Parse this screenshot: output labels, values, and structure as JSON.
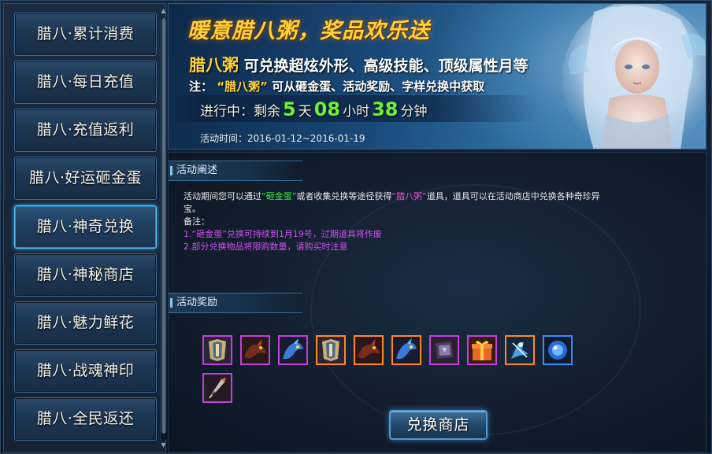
{
  "sidebar": {
    "items": [
      {
        "label": "腊八·累计消费"
      },
      {
        "label": "腊八·每日充值"
      },
      {
        "label": "腊八·充值返利"
      },
      {
        "label": "腊八·好运砸金蛋"
      },
      {
        "label": "腊八·神奇兑换"
      },
      {
        "label": "腊八·神秘商店"
      },
      {
        "label": "腊八·魅力鲜花"
      },
      {
        "label": "腊八·战魂神印"
      },
      {
        "label": "腊八·全民返还"
      }
    ],
    "active_index": 4
  },
  "banner": {
    "title": "暖意腊八粥，奖品欢乐送",
    "line1_highlight": "腊八粥",
    "line1_rest": "可兑换超炫外形、高级技能、顶级属性月等",
    "note_prefix": "注：",
    "note_highlight": "“腊八粥”",
    "note_rest": "可从砸金蛋、活动奖励、字样兑换中获取",
    "countdown": {
      "label": "进行中：剩余",
      "days": "5",
      "days_unit": "天",
      "hours": "08",
      "hours_unit": "小时",
      "minutes": "38",
      "minutes_unit": "分钟"
    },
    "date": "活动时间：2016-01-12~2016-01-19"
  },
  "content": {
    "description_heading": "活动阐述",
    "desc_part1": "活动期间您可以通过",
    "desc_egg": "“砸金蛋”",
    "desc_part2": "或者收集兑换等途径获得",
    "desc_porridge": "“腊八粥”",
    "desc_part3": "道具，道具可以在活动商店中兑换各种奇珍异宝。",
    "notes_label": "备注：",
    "note1": "1.“砸金蛋”兑换可持续到1月19号，过期道具将作废",
    "note2": "2.部分兑换物品将限购数量，请购买时注意",
    "rewards_heading": "活动奖励",
    "rewards": [
      {
        "icon": "armor-icon",
        "rarity": "purple"
      },
      {
        "icon": "dragon-mount-icon",
        "rarity": "purple"
      },
      {
        "icon": "blue-pet-icon",
        "rarity": "purple"
      },
      {
        "icon": "armor-icon",
        "rarity": "orange"
      },
      {
        "icon": "dragon-mount-icon",
        "rarity": "orange"
      },
      {
        "icon": "blue-pet-icon",
        "rarity": "orange"
      },
      {
        "icon": "skill-book-icon",
        "rarity": "purple"
      },
      {
        "icon": "gift-box-icon",
        "rarity": "purple"
      },
      {
        "icon": "warrior-skill-icon",
        "rarity": "orange"
      },
      {
        "icon": "blue-orb-icon",
        "rarity": "purple"
      },
      {
        "icon": "drill-weapon-icon",
        "rarity": "purple"
      }
    ],
    "exchange_button": "兑换商店"
  }
}
